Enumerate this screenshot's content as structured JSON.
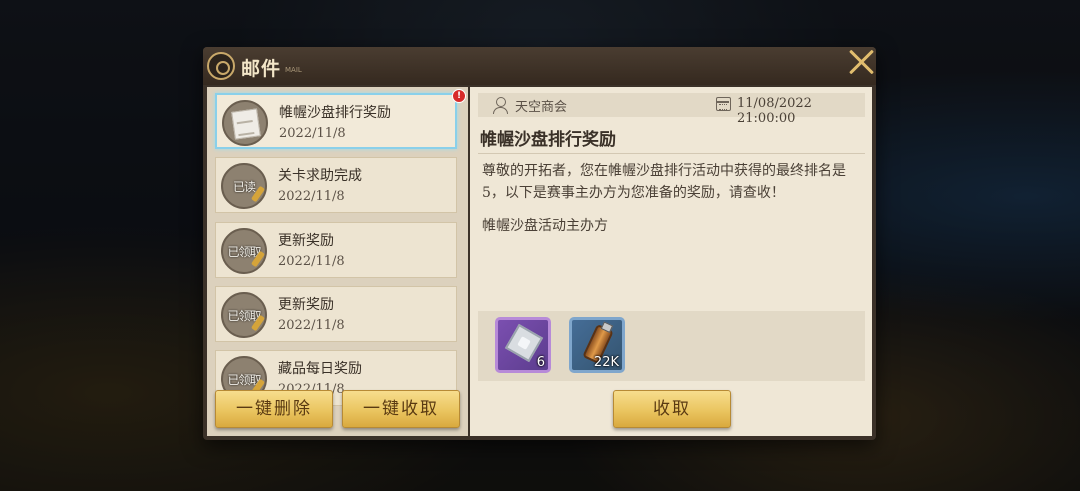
{
  "dialog": {
    "title": "邮件",
    "title_sub": "MAIL"
  },
  "mail_list": [
    {
      "title": "帷幄沙盘排行奖励",
      "date": "2022/11/8",
      "status": "",
      "unread_mark": "!"
    },
    {
      "title": "关卡求助完成",
      "date": "2022/11/8",
      "status": "已读"
    },
    {
      "title": "更新奖励",
      "date": "2022/11/8",
      "status": "已领取"
    },
    {
      "title": "更新奖励",
      "date": "2022/11/8",
      "status": "已领取"
    },
    {
      "title": "藏品每日奖励",
      "date": "2022/11/8",
      "status": "已领取"
    }
  ],
  "actions": {
    "delete_all": "一键删除",
    "collect_all": "一键收取",
    "collect": "收取"
  },
  "detail": {
    "sender": "天空商会",
    "datetime": "11/08/2022 21:00:00",
    "heading": "帷幄沙盘排行奖励",
    "body": "尊敬的开拓者，您在帷幄沙盘排行活动中获得的最终排名是5，以下是赛事主办方为您准备的奖励，请查收！",
    "signature": "帷幄沙盘活动主办方",
    "rewards": [
      {
        "icon": "gem-icon",
        "count": "6",
        "rarity": "purple"
      },
      {
        "icon": "bottle-icon",
        "count": "22K",
        "rarity": "blue"
      }
    ]
  },
  "colors": {
    "accent_gold": "#eac560",
    "selected_border": "#8ad0ea",
    "unread_red": "#d72a2a"
  }
}
